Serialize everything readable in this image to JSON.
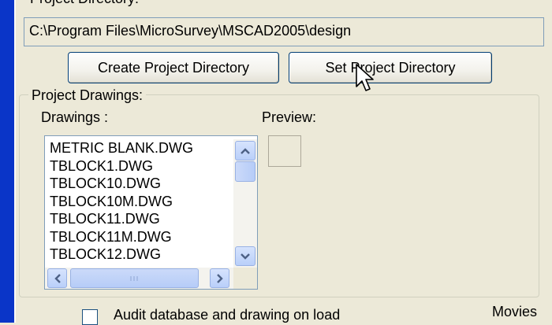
{
  "project_directory": {
    "label": "Project Directory:",
    "path": "C:\\Program Files\\MicroSurvey\\MSCAD2005\\design",
    "create_button": "Create Project Directory",
    "set_button": "Set Project Directory"
  },
  "project_drawings": {
    "group_label": "Project Drawings:",
    "drawings_label": "Drawings :",
    "preview_label": "Preview:",
    "items": [
      "METRIC BLANK.DWG",
      "TBLOCK1.DWG",
      "TBLOCK10.DWG",
      "TBLOCK10M.DWG",
      "TBLOCK11.DWG",
      "TBLOCK11M.DWG",
      "TBLOCK12.DWG"
    ]
  },
  "options": {
    "audit_label": "Audit database and drawing on load",
    "audit_checked": false
  },
  "movies_label": "Movies",
  "icons": {
    "scroll_up": "chevron-up-icon",
    "scroll_down": "chevron-down-icon",
    "scroll_left": "chevron-left-icon",
    "scroll_right": "chevron-right-icon",
    "cursor": "arrow-cursor-icon"
  },
  "colors": {
    "window_border": "#0a35c8",
    "dialog_bg": "#ece9d8",
    "button_border": "#003c74",
    "scrollbar": "#b9cff9"
  }
}
